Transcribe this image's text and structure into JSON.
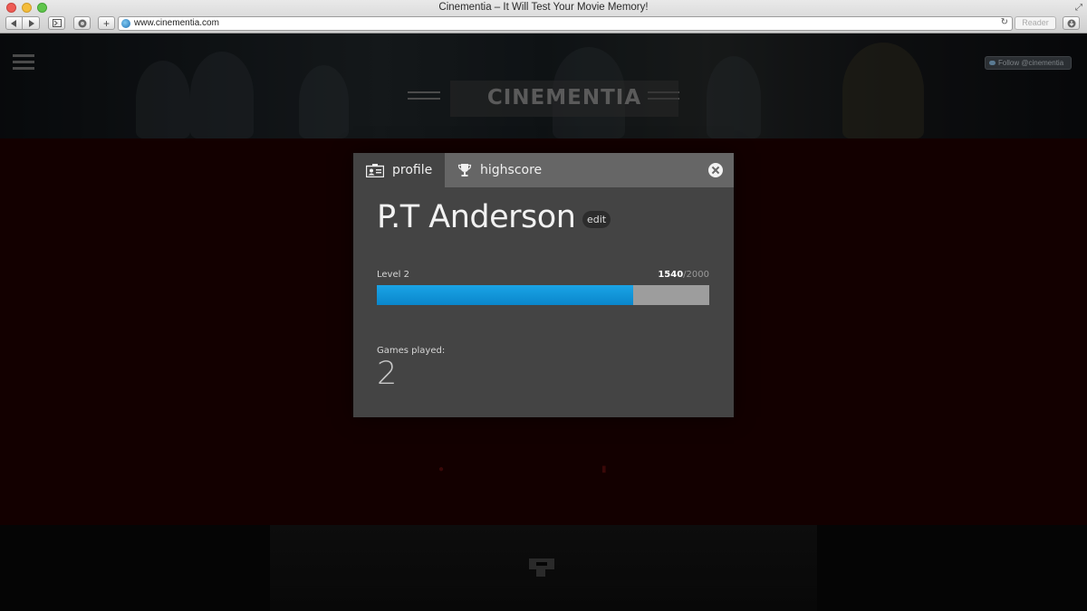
{
  "browser": {
    "window_title": "Cinementia – It Will Test Your Movie Memory!",
    "url": "www.cinementia.com",
    "reader_label": "Reader"
  },
  "site": {
    "logo_text": "CINEMENTIA",
    "follow_label": "Follow @cinementia"
  },
  "modal": {
    "tabs": [
      {
        "label": "profile",
        "icon": "id-card-icon",
        "active": true
      },
      {
        "label": "highscore",
        "icon": "trophy-icon",
        "active": false
      }
    ],
    "user_name": "P.T Anderson",
    "edit_label": "edit",
    "level_label": "Level 2",
    "xp_current": "1540",
    "xp_total": "/2000",
    "progress_fraction": 0.77,
    "games_played_label": "Games played:",
    "games_played_value": "2"
  },
  "colors": {
    "progress_fill": "#0f95d8",
    "modal_bg": "#444444",
    "tab_bar_bg": "#666666",
    "page_band": "#130000"
  }
}
